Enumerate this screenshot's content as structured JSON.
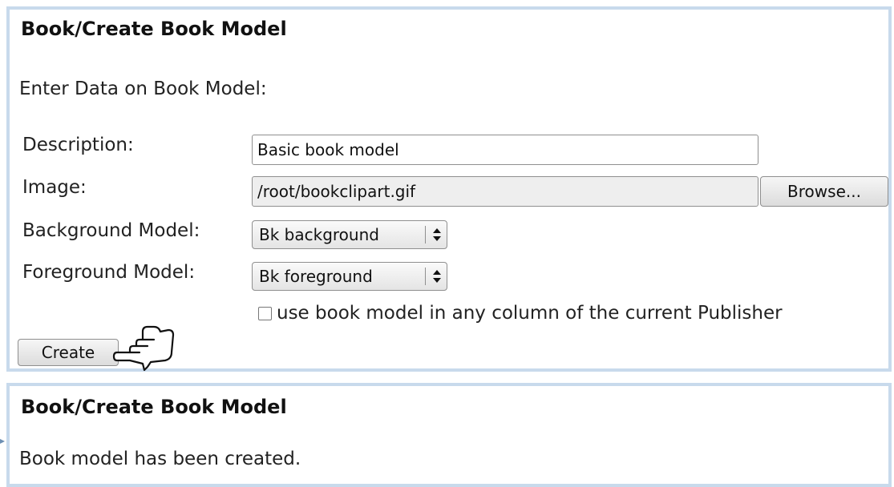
{
  "create_form": {
    "title": "Book/Create Book Model",
    "intro": "Enter Data on Book Model:",
    "description": {
      "label": "Description:",
      "value": "Basic book model"
    },
    "image": {
      "label": "Image:",
      "value": "/root/bookclipart.gif",
      "browse_label": "Browse..."
    },
    "background_model": {
      "label": "Background Model:",
      "selected": "Bk background"
    },
    "foreground_model": {
      "label": "Foreground Model:",
      "selected": "Bk foreground"
    },
    "any_column_checkbox": {
      "label": "use book model in any column of the current Publisher",
      "checked": false
    },
    "create_label": "Create"
  },
  "result_panel": {
    "title": "Book/Create Book Model",
    "message": "Book model has been created."
  },
  "colors": {
    "panel_border": "#c8daec"
  },
  "icons": {
    "pointer": "pointing-hand-icon",
    "select_arrows": "up-down-arrows-icon"
  }
}
